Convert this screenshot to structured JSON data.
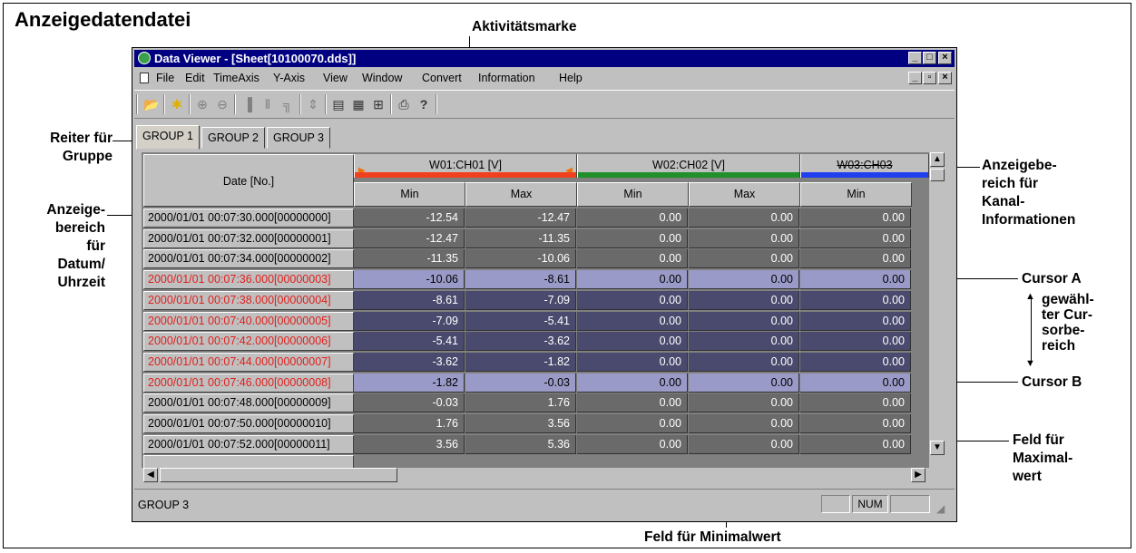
{
  "annotations": {
    "heading": "Anzeigedatendatei",
    "activity_mark": "Aktivitätsmarke",
    "group_tab": [
      "Reiter für",
      "Gruppe"
    ],
    "date_area": [
      "Anzeige-",
      "bereich",
      "für",
      "Datum/",
      "Uhrzeit"
    ],
    "channel_area": [
      "Anzeigebe-",
      "reich für",
      "Kanal-",
      "Informationen"
    ],
    "cursor_a": "Cursor A",
    "cursor_range": [
      "gewähl-",
      "ter Cur-",
      "sorbe-",
      "reich"
    ],
    "cursor_b": "Cursor B",
    "max_field": [
      "Feld für",
      "Maximal-",
      "wert"
    ],
    "min_field": "Feld für Minimalwert"
  },
  "window": {
    "title": "Data Viewer - [Sheet[10100070.dds]]",
    "menu": [
      "File",
      "Edit",
      "TimeAxis",
      "Y-Axis",
      "View",
      "Window",
      "Convert",
      "Information",
      "Help"
    ],
    "tabs": [
      "GROUP 1",
      "GROUP 2",
      "GROUP 3"
    ],
    "date_header": "Date [No.]",
    "channels": [
      {
        "name": "W01:CH01 [V]",
        "color": "#f04020"
      },
      {
        "name": "W02:CH02 [V]",
        "color": "#20902a"
      },
      {
        "name": "W03:CH03",
        "color": "#2040f0"
      }
    ],
    "subheaders": [
      "Min",
      "Max",
      "Min",
      "Max",
      "Min"
    ],
    "rows": [
      {
        "date": "2000/01/01 00:07:30.000[00000000]",
        "values": [
          "-12.54",
          "-12.47",
          "0.00",
          "0.00",
          "0.00"
        ],
        "state": "norm"
      },
      {
        "date": "2000/01/01 00:07:32.000[00000001]",
        "values": [
          "-12.47",
          "-11.35",
          "0.00",
          "0.00",
          "0.00"
        ],
        "state": "norm"
      },
      {
        "date": "2000/01/01 00:07:34.000[00000002]",
        "values": [
          "-11.35",
          "-10.06",
          "0.00",
          "0.00",
          "0.00"
        ],
        "state": "norm"
      },
      {
        "date": "2000/01/01 00:07:36.000[00000003]",
        "values": [
          "-10.06",
          "-8.61",
          "0.00",
          "0.00",
          "0.00"
        ],
        "state": "cursor"
      },
      {
        "date": "2000/01/01 00:07:38.000[00000004]",
        "values": [
          "-8.61",
          "-7.09",
          "0.00",
          "0.00",
          "0.00"
        ],
        "state": "inrange"
      },
      {
        "date": "2000/01/01 00:07:40.000[00000005]",
        "values": [
          "-7.09",
          "-5.41",
          "0.00",
          "0.00",
          "0.00"
        ],
        "state": "inrange"
      },
      {
        "date": "2000/01/01 00:07:42.000[00000006]",
        "values": [
          "-5.41",
          "-3.62",
          "0.00",
          "0.00",
          "0.00"
        ],
        "state": "inrange"
      },
      {
        "date": "2000/01/01 00:07:44.000[00000007]",
        "values": [
          "-3.62",
          "-1.82",
          "0.00",
          "0.00",
          "0.00"
        ],
        "state": "inrange"
      },
      {
        "date": "2000/01/01 00:07:46.000[00000008]",
        "values": [
          "-1.82",
          "-0.03",
          "0.00",
          "0.00",
          "0.00"
        ],
        "state": "cursor"
      },
      {
        "date": "2000/01/01 00:07:48.000[00000009]",
        "values": [
          "-0.03",
          "1.76",
          "0.00",
          "0.00",
          "0.00"
        ],
        "state": "norm"
      },
      {
        "date": "2000/01/01 00:07:50.000[00000010]",
        "values": [
          "1.76",
          "3.56",
          "0.00",
          "0.00",
          "0.00"
        ],
        "state": "norm"
      },
      {
        "date": "2000/01/01 00:07:52.000[00000011]",
        "values": [
          "3.56",
          "5.36",
          "0.00",
          "0.00",
          "0.00"
        ],
        "state": "norm"
      }
    ],
    "status_text": "GROUP 3",
    "status_num": "NUM"
  }
}
